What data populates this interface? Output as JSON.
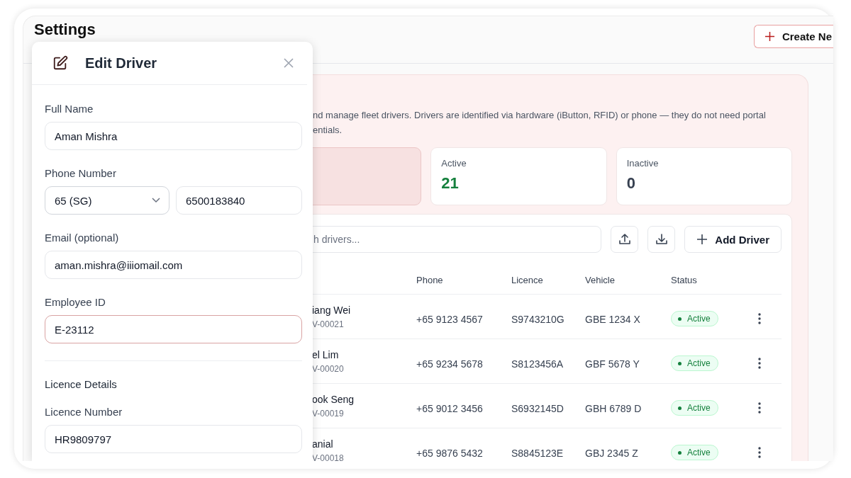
{
  "page": {
    "title": "Settings",
    "create_button": "Create Ne"
  },
  "description_lines": [
    "nd manage fleet drivers. Drivers are identified via hardware (iButton, RFID) or phone — they do not need portal",
    "entials."
  ],
  "stats": [
    {
      "selected": true
    },
    {
      "label": "Active",
      "value": "21",
      "selected": false,
      "color": "#15803d"
    },
    {
      "label": "Inactive",
      "value": "0",
      "selected": false,
      "color": "#374151"
    }
  ],
  "toolbar": {
    "search_placeholder": "h drivers...",
    "add_button": "Add Driver"
  },
  "table": {
    "columns": [
      "Phone",
      "Licence",
      "Vehicle",
      "Status"
    ],
    "rows": [
      {
        "name": "iang Wei",
        "id": "V-00021",
        "phone": "+65 9123 4567",
        "licence": "S9743210G",
        "vehicle": "GBE 1234 X",
        "status": "Active",
        "active": true
      },
      {
        "name": "el Lim",
        "id": "V-00020",
        "phone": "+65 9234 5678",
        "licence": "S8123456A",
        "vehicle": "GBF 5678 Y",
        "status": "Active",
        "active": true
      },
      {
        "name": "ook Seng",
        "id": "V-00019",
        "phone": "+65 9012 3456",
        "licence": "S6932145D",
        "vehicle": "GBH 6789 D",
        "status": "Active",
        "active": true
      },
      {
        "name": "anial",
        "id": "V-00018",
        "phone": "+65 9876 5432",
        "licence": "S8845123E",
        "vehicle": "GBJ 2345 Z",
        "status": "Active",
        "active": true
      }
    ]
  },
  "modal": {
    "title": "Edit Driver",
    "fields": [
      {
        "kind": "text",
        "label": "Full Name",
        "value": "Aman Mishra",
        "focused": false
      },
      {
        "kind": "phone",
        "label": "Phone Number",
        "country": "65 (SG)",
        "value": "6500183840"
      },
      {
        "kind": "text",
        "label": "Email (optional)",
        "value": "aman.mishra@iiiomail.com",
        "focused": false
      },
      {
        "kind": "text",
        "label": "Employee ID",
        "value": "E-23112",
        "focused": true
      },
      {
        "kind": "section",
        "label": "Licence Details"
      },
      {
        "kind": "text",
        "label": "Licence Number",
        "value": "HR9809797",
        "focused": false
      }
    ]
  }
}
